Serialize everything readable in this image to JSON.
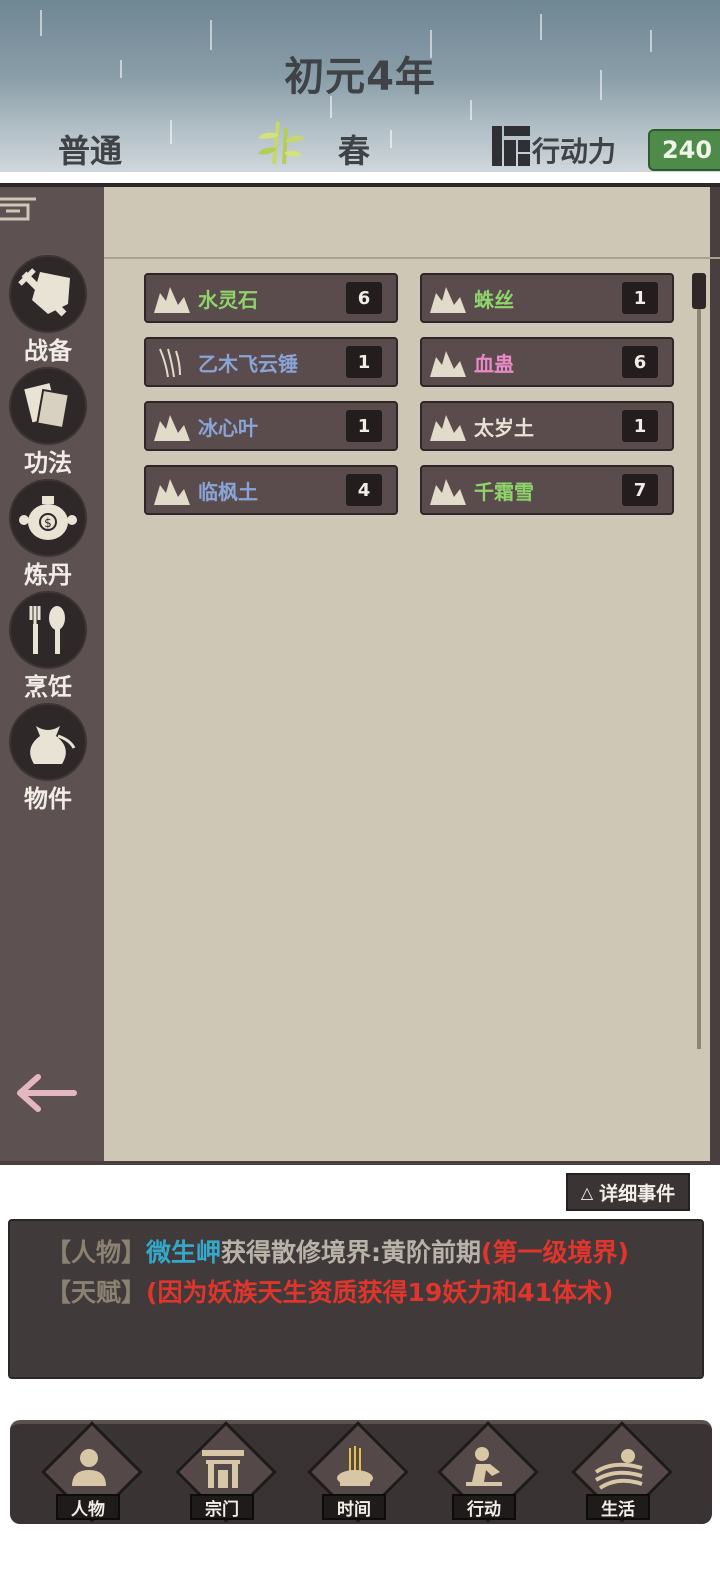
{
  "header": {
    "year": "初元4年",
    "mode": "普通",
    "season": "春",
    "action_label": "行动力",
    "action_value": "240"
  },
  "sidebar": {
    "items": [
      {
        "label": "战备",
        "icon": "sword-shield-icon"
      },
      {
        "label": "功法",
        "icon": "scroll-book-icon"
      },
      {
        "label": "炼丹",
        "icon": "cauldron-icon"
      },
      {
        "label": "烹饪",
        "icon": "utensils-icon"
      },
      {
        "label": "物件",
        "icon": "pouch-icon"
      }
    ]
  },
  "inventory": {
    "items": [
      {
        "name": "水灵石",
        "count": "6",
        "color": "#8fd46a",
        "icon": "ore-icon"
      },
      {
        "name": "蛛丝",
        "count": "1",
        "color": "#8fd46a",
        "icon": "ore-icon"
      },
      {
        "name": "乙木飞云锤",
        "count": "1",
        "color": "#8aa4d8",
        "icon": "claw-icon"
      },
      {
        "name": "血蛊",
        "count": "6",
        "color": "#e88ac8",
        "icon": "ore-icon"
      },
      {
        "name": "冰心叶",
        "count": "1",
        "color": "#8aa4d8",
        "icon": "ore-icon"
      },
      {
        "name": "太岁土",
        "count": "1",
        "color": "#e8e2d6",
        "icon": "ore-icon"
      },
      {
        "name": "临枫土",
        "count": "4",
        "color": "#8aa4d8",
        "icon": "ore-icon"
      },
      {
        "name": "千霜雪",
        "count": "7",
        "color": "#8fd46a",
        "icon": "ore-icon"
      }
    ]
  },
  "events": {
    "detail_label": "详细事件",
    "lines": [
      {
        "tag": "【人物】",
        "name": "微生岬",
        "text": "获得散修境界:黄阶前期",
        "note": "(第一级境界)"
      },
      {
        "tag": "【天赋】",
        "note": "(因为妖族天生资质获得19妖力和41体术)"
      }
    ]
  },
  "nav": {
    "items": [
      {
        "label": "人物",
        "icon": "person-icon"
      },
      {
        "label": "宗门",
        "icon": "gate-icon"
      },
      {
        "label": "时间",
        "icon": "incense-icon"
      },
      {
        "label": "行动",
        "icon": "action-icon"
      },
      {
        "label": "生活",
        "icon": "sunrise-icon"
      }
    ]
  }
}
